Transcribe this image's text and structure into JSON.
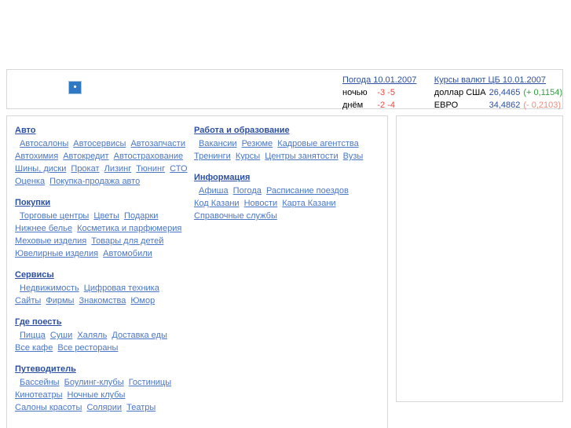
{
  "header": {
    "logo_icon": "broken-image-icon",
    "weather": {
      "link_label": "Погода 10.01.2007",
      "rows": [
        {
          "label": "ночью",
          "value": "-3 -5"
        },
        {
          "label": "днём",
          "value": "-2 -4"
        }
      ]
    },
    "currency": {
      "link_label": "Курсы валют ЦБ 10.01.2007",
      "rows": [
        {
          "name": "доллар США",
          "value": "26,4465",
          "delta": "(+ 0,1154)",
          "direction": "up"
        },
        {
          "name": "ЕВРО",
          "value": "34,4862",
          "delta": "(- 0,2103)",
          "direction": "down"
        }
      ]
    }
  },
  "colors": {
    "link": "#4a76c8",
    "heading_link": "#2b4fa2",
    "temperature": "#e8483c",
    "currency_value": "#2b4fa2",
    "delta_up": "#2f9e3f",
    "delta_down": "#f08a7a",
    "panel_border": "#d6d6d6"
  },
  "nav": {
    "left_column": [
      {
        "title": "Авто",
        "links": [
          "Автосалоны",
          "Автосервисы",
          "Автозапчасти",
          "Автохимия",
          "Автокредит",
          "Автострахование",
          "Шины, диски",
          "Прокат",
          "Лизинг",
          "Тюнинг",
          "СТО",
          "Оценка",
          "Покупка-продажа авто"
        ]
      },
      {
        "title": "Покупки",
        "links": [
          "Торговые центры",
          "Цветы",
          "Подарки",
          "Нижнее белье",
          "Косметика и парфюмерия",
          "Меховые изделия",
          "Товары для детей",
          "Ювелирные изделия",
          "Автомобили"
        ]
      },
      {
        "title": "Сервисы",
        "links": [
          "Недвижимость",
          "Цифровая техника",
          "Сайты",
          "Фирмы",
          "Знакомства",
          "Юмор"
        ]
      },
      {
        "title": "Где поесть",
        "links": [
          "Пицца",
          "Суши",
          "Халяль",
          "Доставка еды",
          "Все кафе",
          "Все рестораны"
        ]
      },
      {
        "title": "Путеводитель",
        "links": [
          "Бассейны",
          "Боулинг-клубы",
          "Гостиницы",
          "Кинотеатры",
          "Ночные клубы",
          "Салоны красоты",
          "Солярии",
          "Театры"
        ]
      }
    ],
    "right_column": [
      {
        "title": "Работа и образование",
        "links": [
          "Вакансии",
          "Резюме",
          "Кадровые агентства",
          "Тренинги",
          "Курсы",
          "Центры занятости",
          "Вузы"
        ]
      },
      {
        "title": "Информация",
        "links": [
          "Афиша",
          "Погода",
          "Расписание поездов",
          "Код Казани",
          "Новости",
          "Карта Казани",
          "Справочные службы"
        ]
      }
    ]
  }
}
